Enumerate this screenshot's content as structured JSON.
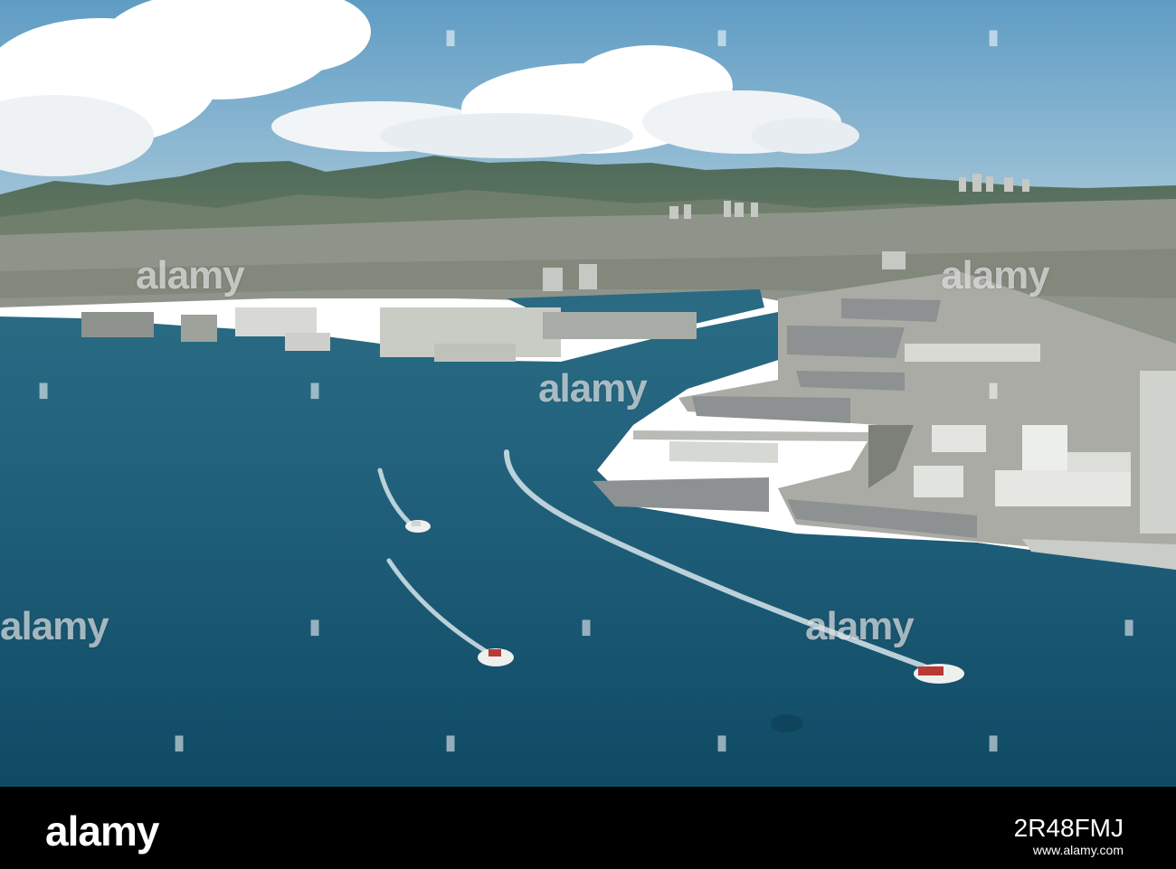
{
  "photo": {
    "subject": "aerial-harbor-naval-base",
    "colors": {
      "sky": "#7fb0d0",
      "water": "#1c5a76",
      "land": "#8a8f84",
      "cloud": "#ffffff"
    }
  },
  "watermark": {
    "text": "alamy"
  },
  "footer": {
    "logo": "alamy",
    "image_id": "2R48FMJ",
    "url": "www.alamy.com"
  }
}
